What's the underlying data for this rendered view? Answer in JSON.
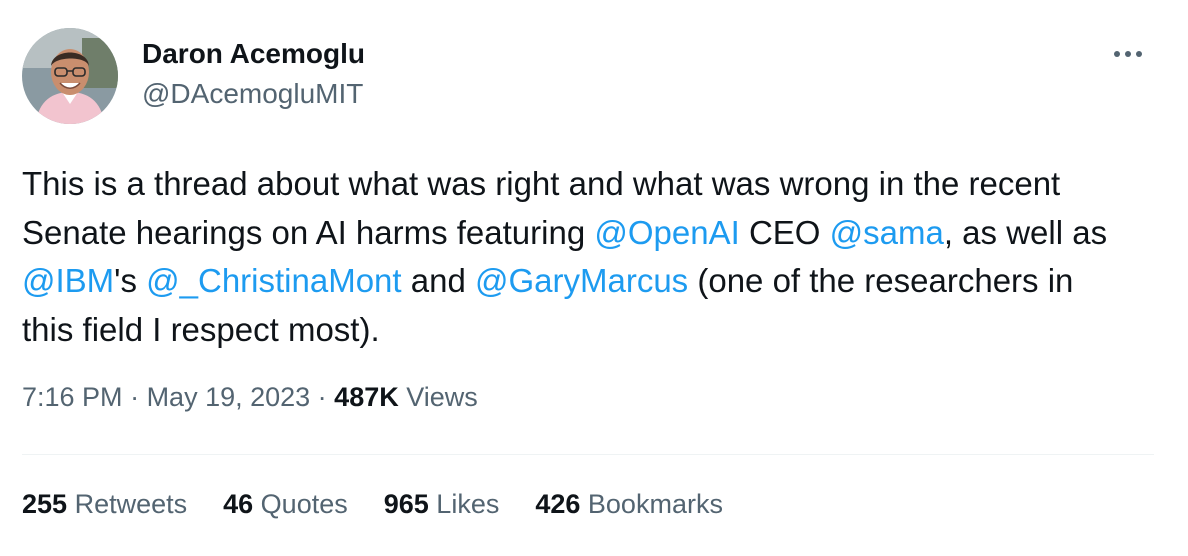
{
  "author": {
    "display_name": "Daron Acemoglu",
    "handle": "@DAcemogluMIT"
  },
  "more_icon": "more-horizontal-icon",
  "tweet": {
    "lines": [
      [
        {
          "text": "This is a thread about what was right and what was wrong in the recent"
        }
      ],
      [
        {
          "text": "Senate hearings on AI harms featuring "
        },
        {
          "text": "@OpenAI",
          "mention": true
        },
        {
          "text": " CEO "
        },
        {
          "text": "@sama",
          "mention": true
        },
        {
          "text": ", as well as"
        }
      ],
      [
        {
          "text": "@IBM",
          "mention": true
        },
        {
          "text": "'s "
        },
        {
          "text": "@_ChristinaMont",
          "mention": true
        },
        {
          "text": " and "
        },
        {
          "text": "@GaryMarcus",
          "mention": true
        },
        {
          "text": " (one of the researchers in"
        }
      ],
      [
        {
          "text": "this field I respect most)."
        }
      ]
    ]
  },
  "meta": {
    "time": "7:16 PM",
    "separator": " · ",
    "date": "May 19, 2023",
    "views_count": "487K",
    "views_label": " Views"
  },
  "stats": [
    {
      "count": "255",
      "label": " Retweets"
    },
    {
      "count": "46",
      "label": " Quotes"
    },
    {
      "count": "965",
      "label": " Likes"
    },
    {
      "count": "426",
      "label": " Bookmarks"
    }
  ],
  "colors": {
    "mention": "#1d9bf0",
    "text": "#0f1419",
    "secondary": "#536471",
    "divider": "#eff3f4"
  }
}
